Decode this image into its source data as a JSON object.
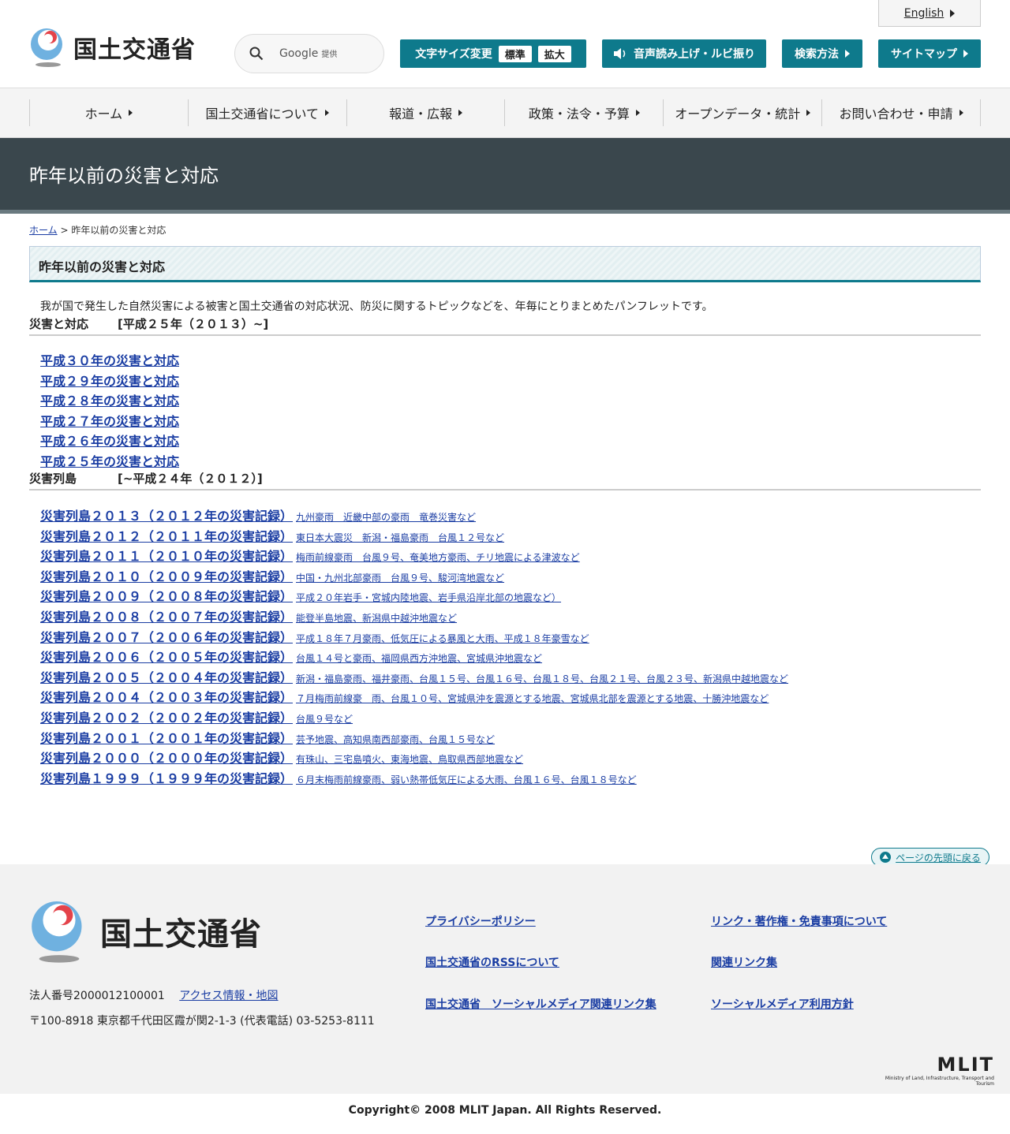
{
  "header": {
    "logo_text": "国土交通省",
    "search": {
      "provider": "Google",
      "provided": "提供"
    },
    "english": "English",
    "font_size_label": "文字サイズ変更",
    "font_std": "標準",
    "font_large": "拡大",
    "voice": "音声読み上げ・ルビ振り",
    "search_method": "検索方法",
    "sitemap": "サイトマップ"
  },
  "nav": [
    {
      "label": "ホーム"
    },
    {
      "label": "国土交通省について"
    },
    {
      "label": "報道・広報"
    },
    {
      "label": "政策・法令・予算"
    },
    {
      "label": "オープンデータ・統計"
    },
    {
      "label": "お問い合わせ・申請"
    }
  ],
  "page": {
    "title": "昨年以前の災害と対応",
    "breadcrumb_home": "ホーム",
    "breadcrumb_sep": ">",
    "breadcrumb_current": "昨年以前の災害と対応",
    "heading": "昨年以前の災害と対応",
    "intro": "我が国で発生した自然災害による被害と国土交通省の対応状況、防災に関するトピックなどを、年毎にとりまとめたパンフレットです。"
  },
  "section1": {
    "title_a": "災害と対応",
    "title_b": "[平成２５年（２０１３）~]",
    "links": [
      "平成３０年の災害と対応",
      "平成２９年の災害と対応",
      "平成２８年の災害と対応",
      "平成２７年の災害と対応",
      "平成２６年の災害と対応",
      "平成２５年の災害と対応"
    ]
  },
  "section2": {
    "title_a": "災害列島",
    "title_b": "[~平成２４年（２０１２）]",
    "links": [
      {
        "main": "災害列島２０１３（２０１２年の災害記録）",
        "sub": "九州豪雨　近畿中部の豪雨　竜巻災害など"
      },
      {
        "main": "災害列島２０１２（２０１１年の災害記録）",
        "sub": "東日本大震災　新潟・福島豪雨　台風１２号など"
      },
      {
        "main": "災害列島２０１１（２０１０年の災害記録）",
        "sub": "梅雨前線豪雨　台風９号、奄美地方豪雨、チリ地震による津波など"
      },
      {
        "main": "災害列島２０１０（２００９年の災害記録）",
        "sub": "中国・九州北部豪雨　台風９号、駿河湾地震など"
      },
      {
        "main": "災害列島２００９（２００８年の災害記録）",
        "sub": "平成２０年岩手・宮城内陸地震、岩手県沿岸北部の地震など）"
      },
      {
        "main": "災害列島２００８（２００７年の災害記録）",
        "sub": "能登半島地震、新潟県中越沖地震など"
      },
      {
        "main": "災害列島２００７（２００６年の災害記録）",
        "sub": "平成１８年７月豪雨、低気圧による暴風と大雨、平成１８年豪雪など"
      },
      {
        "main": "災害列島２００６（２００５年の災害記録）",
        "sub": "台風１４号と豪雨、福岡県西方沖地震、宮城県沖地震など"
      },
      {
        "main": "災害列島２００５（２００４年の災害記録）",
        "sub": "新潟・福島豪雨、福井豪雨、台風１５号、台風１６号、台風１８号、台風２１号、台風２３号、新潟県中越地震など"
      },
      {
        "main": "災害列島２００４（２００３年の災害記録）",
        "sub": "７月梅雨前線豪　雨、台風１０号、宮城県沖を震源とする地震、宮城県北部を震源とする地震、十勝沖地震など"
      },
      {
        "main": "災害列島２００２（２００２年の災害記録）",
        "sub": "台風９号など"
      },
      {
        "main": "災害列島２００１（２００１年の災害記録）",
        "sub": "芸予地震、高知県南西部豪雨、台風１５号など"
      },
      {
        "main": "災害列島２０００（２０００年の災害記録）",
        "sub": "有珠山、三宅島噴火、東海地震、鳥取県西部地震など"
      },
      {
        "main": "災害列島１９９９（１９９９年の災害記録）",
        "sub": "６月末梅雨前線豪雨、弱い熱帯低気圧による大雨、台風１６号、台風１８号など"
      }
    ]
  },
  "pagetop": "ページの先頭に戻る",
  "footer": {
    "logo_text": "国土交通省",
    "corp_no": "法人番号2000012100001",
    "access": "アクセス情報・地図",
    "address": "〒100-8918 東京都千代田区霞が関2-1-3 (代表電話) 03-5253-8111",
    "links": {
      "privacy": "プライバシーポリシー",
      "copyright_links": "リンク・著作権・免責事項について",
      "rss": "国土交通省のRSSについて",
      "related": "関連リンク集",
      "social_links": "国土交通省　ソーシャルメディア関連リンク集",
      "social_policy": "ソーシャルメディア利用方針"
    },
    "mlit": "MLIT",
    "mlit_sub": "Ministry of Land, Infrastructure, Transport and Tourism"
  },
  "copyright": "Copyright© 2008 MLIT Japan. All Rights Reserved.",
  "colors": {
    "accent": "#0e7a8c",
    "title_bar": "#3a474d",
    "link": "#1a3da3"
  }
}
